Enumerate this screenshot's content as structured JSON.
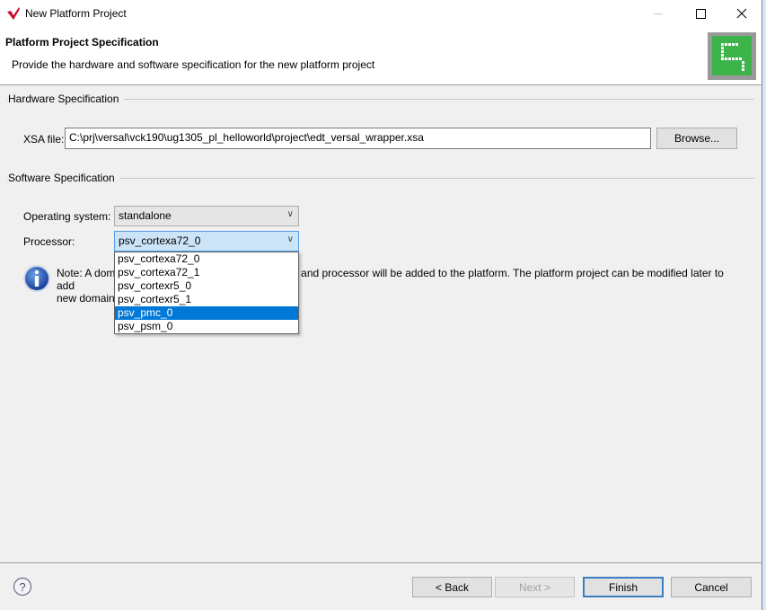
{
  "window": {
    "title": "New Platform Project",
    "controls": {
      "minimize": "—",
      "maximize": "☐",
      "close": "✕"
    }
  },
  "banner": {
    "title": "Platform Project Specification",
    "description": "Provide the hardware and software specification for the new platform project"
  },
  "hardware": {
    "group_label": "Hardware Specification",
    "xsa_label": "XSA file:",
    "xsa_value": "C:\\prj\\versal\\vck190\\ug1305_pl_helloworld\\project\\edt_versal_wrapper.xsa",
    "browse_label": "Browse..."
  },
  "software": {
    "group_label": "Software Specification",
    "os_label": "Operating system:",
    "os_value": "standalone",
    "processor_label": "Processor:",
    "processor_value": "psv_cortexa72_0",
    "processor_options": [
      "psv_cortexa72_0",
      "psv_cortexa72_1",
      "psv_cortexr5_0",
      "psv_cortexr5_1",
      "psv_pmc_0",
      "psv_psm_0"
    ],
    "highlighted_option": "psv_pmc_0",
    "note_line1": "Note: A domain with the selected operating system and processor will be added to the platform. The platform project can be modified later to add",
    "note_line2": "new domains."
  },
  "footer": {
    "back_label": "< Back",
    "next_label": "Next >",
    "finish_label": "Finish",
    "cancel_label": "Cancel"
  },
  "colors": {
    "selection": "#0078d7",
    "banner_icon_green": "#3cb44a",
    "default_button_border": "#3a7fc1"
  }
}
